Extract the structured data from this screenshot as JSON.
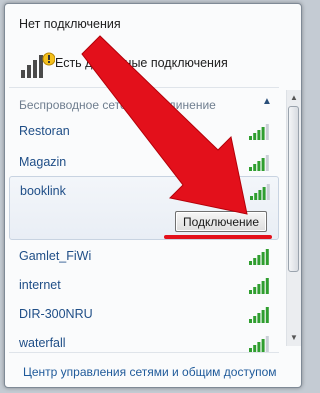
{
  "status": {
    "title": "Нет подключения",
    "subtitle": "Есть доступные подключения"
  },
  "section": {
    "header": "Беспроводное сетевое соединение",
    "collapse_icon": "chevron-up"
  },
  "networks": [
    {
      "name": "Restoran",
      "signal": 4
    },
    {
      "name": "Magazin",
      "signal": 4
    },
    {
      "name": "booklink",
      "signal": 4,
      "expanded": true,
      "action_label": "Подключение"
    },
    {
      "name": "Gamlet_FiWi",
      "signal": 5
    },
    {
      "name": "internet",
      "signal": 5
    },
    {
      "name": "DIR-300NRU",
      "signal": 5
    },
    {
      "name": "waterfall",
      "signal": 4
    }
  ],
  "footer": {
    "link": "Центр управления сетями и общим доступом"
  },
  "colors": {
    "accent_red": "#e3101b",
    "signal_green": "#2f9e2f",
    "link_blue": "#1f5a9a"
  }
}
